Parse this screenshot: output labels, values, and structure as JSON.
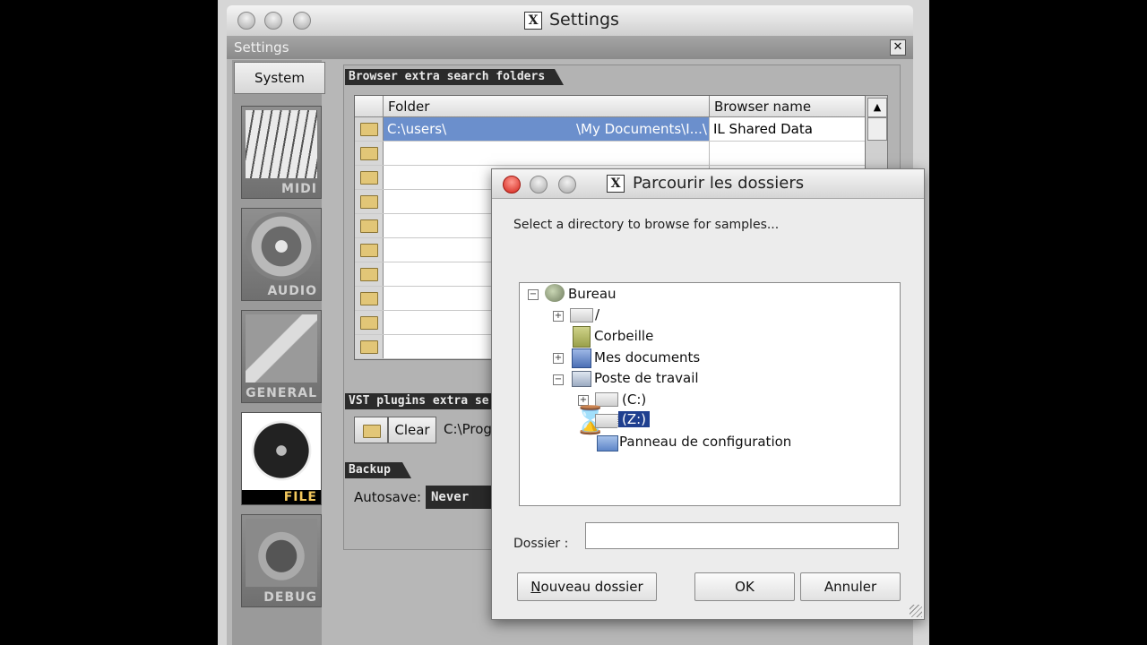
{
  "mac_window": {
    "title": "Settings"
  },
  "fl_window": {
    "title": "Settings",
    "close_glyph": "✕"
  },
  "sidebar": {
    "system_label": "System",
    "categories": [
      {
        "label": "MIDI",
        "icon": "keyboard-icon"
      },
      {
        "label": "AUDIO",
        "icon": "speaker-icon"
      },
      {
        "label": "GENERAL",
        "icon": "wrench-icon"
      },
      {
        "label": "FILE",
        "icon": "disc-icon",
        "active": true
      },
      {
        "label": "DEBUG",
        "icon": "bug-icon"
      }
    ]
  },
  "browser_section": {
    "title": "Browser extra search folders",
    "col_folder": "Folder",
    "col_name": "Browser name",
    "rows": [
      {
        "folder_start": "C:\\users\\",
        "folder_end": "\\My Documents\\I...\\",
        "name": "IL Shared Data"
      },
      {
        "folder_start": "",
        "folder_end": "",
        "name": ""
      },
      {
        "folder_start": "",
        "folder_end": "",
        "name": ""
      },
      {
        "folder_start": "",
        "folder_end": "",
        "name": ""
      },
      {
        "folder_start": "",
        "folder_end": "",
        "name": ""
      },
      {
        "folder_start": "",
        "folder_end": "",
        "name": ""
      },
      {
        "folder_start": "",
        "folder_end": "",
        "name": ""
      },
      {
        "folder_start": "",
        "folder_end": "",
        "name": ""
      },
      {
        "folder_start": "",
        "folder_end": "",
        "name": ""
      },
      {
        "folder_start": "",
        "folder_end": "",
        "name": ""
      }
    ]
  },
  "vst_section": {
    "title": "VST plugins extra se",
    "clear_label": "Clear",
    "path": "C:\\Prog"
  },
  "backup_section": {
    "title": "Backup",
    "autosave_label": "Autosave:",
    "autosave_value": "Never (ju"
  },
  "dialog": {
    "title": "Parcourir les dossiers",
    "prompt": "Select a directory to browse for samples...",
    "tree": {
      "root": "Bureau",
      "slash": "/",
      "trash": "Corbeille",
      "docs": "Mes documents",
      "workstation": "Poste de travail",
      "drive_c": "(C:)",
      "drive_z": "(Z:)",
      "control_panel": "Panneau de configuration"
    },
    "folder_label": "Dossier :",
    "folder_value": "",
    "new_folder_label": "Nouveau dossier",
    "ok_label": "OK",
    "cancel_label": "Annuler"
  }
}
